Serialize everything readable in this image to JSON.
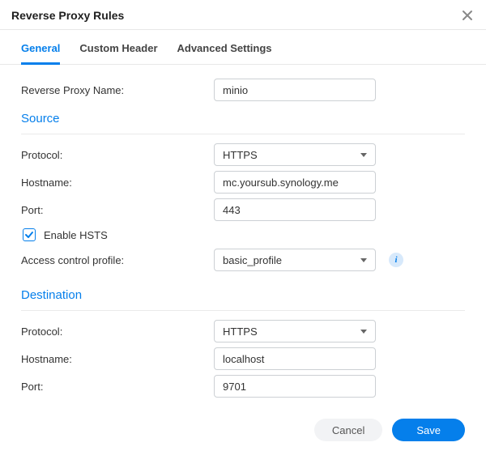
{
  "window": {
    "title": "Reverse Proxy Rules"
  },
  "tabs": {
    "general": "General",
    "custom_header": "Custom Header",
    "advanced": "Advanced Settings",
    "active": "general"
  },
  "labels": {
    "name": "Reverse Proxy Name:",
    "protocol": "Protocol:",
    "hostname": "Hostname:",
    "port": "Port:",
    "enable_hsts": "Enable HSTS",
    "access_profile": "Access control profile:"
  },
  "sections": {
    "source": "Source",
    "destination": "Destination"
  },
  "values": {
    "name": "minio",
    "source": {
      "protocol": "HTTPS",
      "hostname": "mc.yoursub.synology.me",
      "port": "443",
      "hsts": true,
      "access_profile": "basic_profile"
    },
    "destination": {
      "protocol": "HTTPS",
      "hostname": "localhost",
      "port": "9701"
    }
  },
  "buttons": {
    "cancel": "Cancel",
    "save": "Save"
  }
}
